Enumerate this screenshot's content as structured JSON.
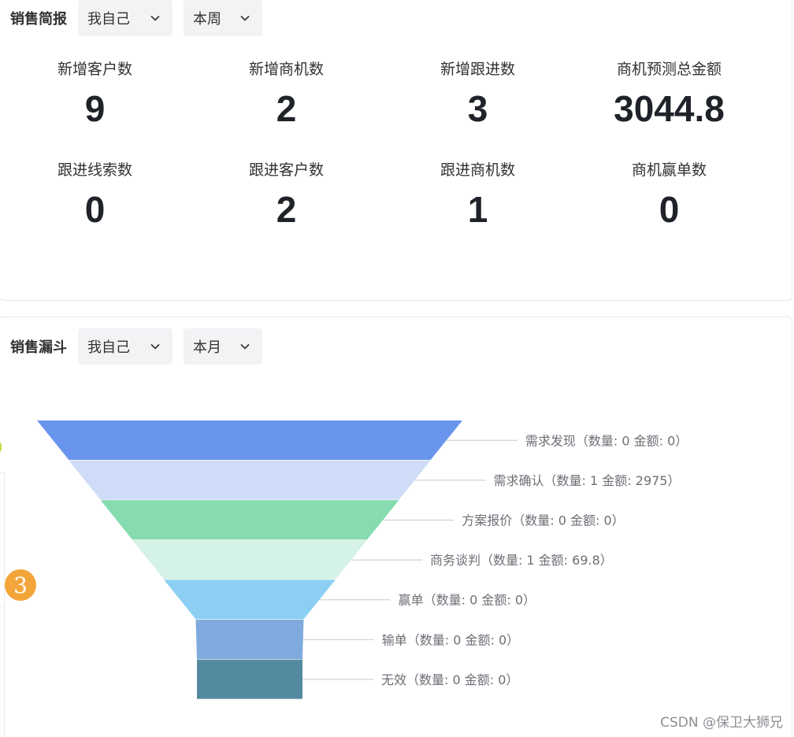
{
  "sales_report": {
    "title": "销售简报",
    "owner_select": "我自己",
    "period_select": "本周",
    "stats": [
      {
        "label": "新增客户数",
        "value": "9"
      },
      {
        "label": "新增商机数",
        "value": "2"
      },
      {
        "label": "新增跟进数",
        "value": "3"
      },
      {
        "label": "商机预测总金额",
        "value": "3044.8"
      },
      {
        "label": "跟进线索数",
        "value": "0"
      },
      {
        "label": "跟进客户数",
        "value": "2"
      },
      {
        "label": "跟进商机数",
        "value": "1"
      },
      {
        "label": "商机赢单数",
        "value": "0"
      }
    ]
  },
  "sales_funnel": {
    "title": "销售漏斗",
    "owner_select": "我自己",
    "period_select": "本月"
  },
  "chart_data": {
    "type": "funnel",
    "stages": [
      {
        "name": "需求发现",
        "count": 0,
        "amount": 0,
        "label": "需求发现（数量: 0 金额: 0）",
        "color": "#6a95ee"
      },
      {
        "name": "需求确认",
        "count": 1,
        "amount": 2975,
        "label": "需求确认（数量: 1 金额: 2975）",
        "color": "#cfdcf7"
      },
      {
        "name": "方案报价",
        "count": 0,
        "amount": 0,
        "label": "方案报价（数量: 0 金额: 0）",
        "color": "#86dbaf"
      },
      {
        "name": "商务谈判",
        "count": 1,
        "amount": 69.8,
        "label": "商务谈判（数量: 1 金额: 69.8）",
        "color": "#d4f2e6"
      },
      {
        "name": "赢单",
        "count": 0,
        "amount": 0,
        "label": "赢单（数量: 0 金额: 0）",
        "color": "#8ccff2"
      },
      {
        "name": "输单",
        "count": 0,
        "amount": 0,
        "label": "输单（数量: 0 金额: 0）",
        "color": "#7faadd"
      },
      {
        "name": "无效",
        "count": 0,
        "amount": 0,
        "label": "无效（数量: 0 金额: 0）",
        "color": "#538aa0"
      }
    ]
  },
  "overlay": {
    "step_badge": "3",
    "watermark": "CSDN @保卫大狮兄"
  },
  "colors": {
    "border": "#e6e8eb",
    "select_bg": "#f2f3f5",
    "badge": "#f3a53a"
  }
}
